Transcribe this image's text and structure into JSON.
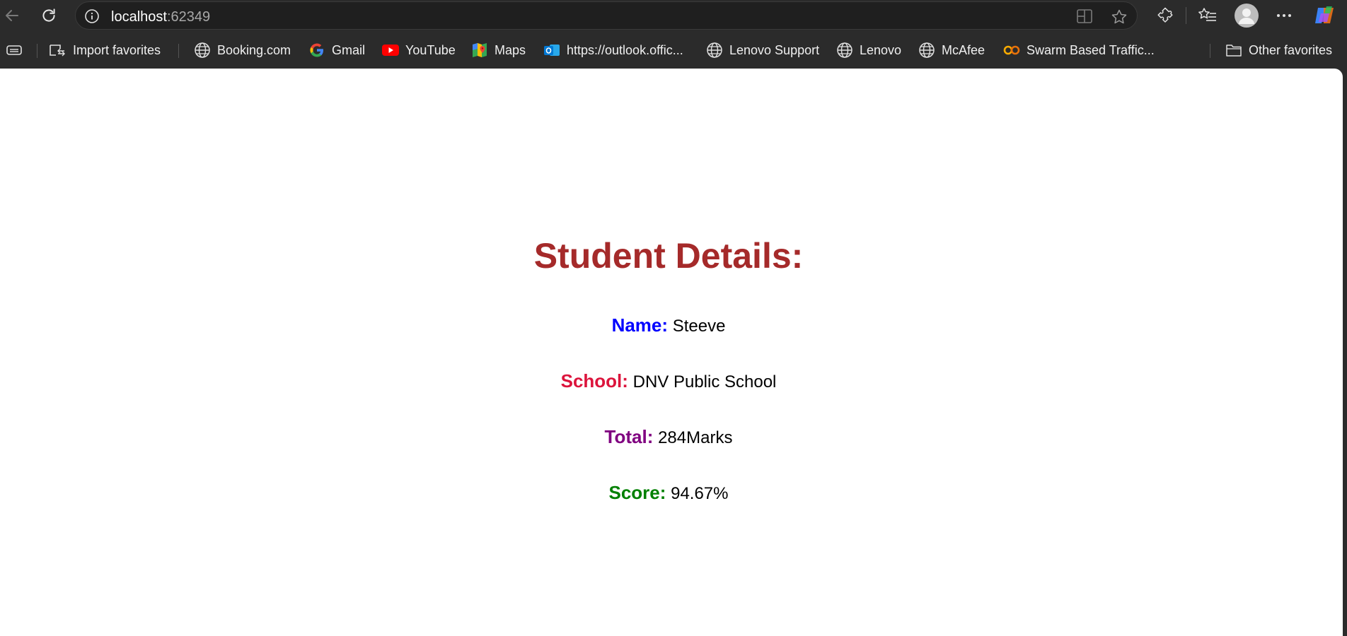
{
  "browser": {
    "url_host": "localhost",
    "url_port": ":62349",
    "colors": {
      "chrome_bg": "#2b2b2b",
      "address_bg": "#1f1f1f"
    }
  },
  "bookmarks": {
    "import": "Import favorites",
    "items": [
      "Booking.com",
      "Gmail",
      "YouTube",
      "Maps",
      "https://outlook.offic...",
      "Lenovo Support",
      "Lenovo",
      "McAfee",
      "Swarm Based Traffic..."
    ],
    "other": "Other favorites"
  },
  "page": {
    "title": "Student Details:",
    "name_label": "Name:",
    "name_value": "Steeve",
    "school_label": "School:",
    "school_value": "DNV Public School",
    "total_label": "Total:",
    "total_value": "284Marks",
    "score_label": "Score:",
    "score_value": "94.67%",
    "colors": {
      "title": "#a52a2a",
      "name": "#0000ff",
      "school": "#dc143c",
      "total": "#800080",
      "score": "#008000"
    }
  }
}
